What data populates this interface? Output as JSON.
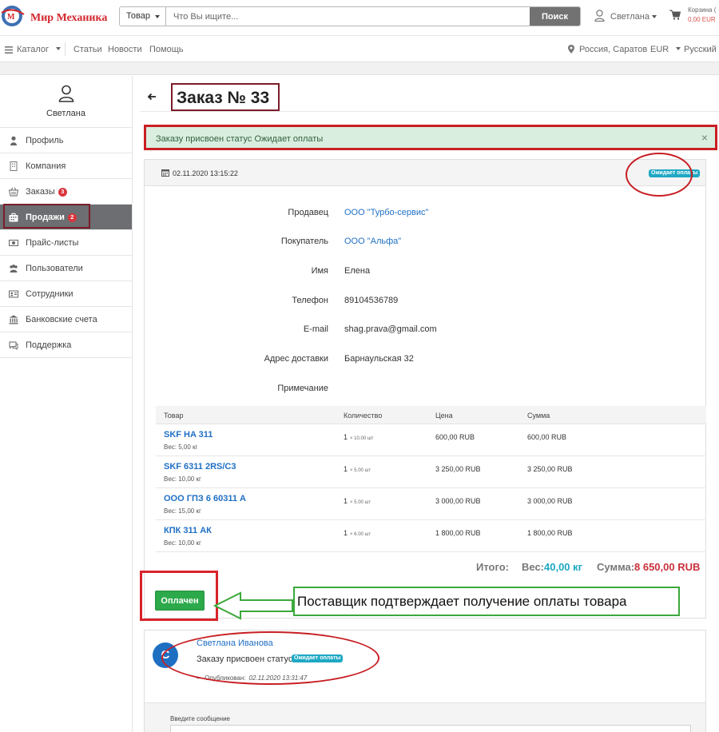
{
  "header": {
    "logo_text": "Мир Механика",
    "search": {
      "type_label": "Товар",
      "placeholder": "Что Вы ищите...",
      "button_label": "Поиск"
    },
    "user_label": "Светлана",
    "cart": {
      "label": "Корзина (",
      "total": "0,00 EUR"
    }
  },
  "nav": {
    "catalog": "Каталог",
    "articles": "Статьи",
    "news": "Новости",
    "help": "Помощь",
    "location": "Россия, Саратов",
    "currency": "EUR",
    "language": "Русский"
  },
  "sidebar": {
    "user_name": "Светлана",
    "items": [
      {
        "label": "Профиль",
        "icon": "person-icon"
      },
      {
        "label": "Компания",
        "icon": "building-icon"
      },
      {
        "label": "Заказы",
        "icon": "basket-icon",
        "badge": "3"
      },
      {
        "label": "Продажи",
        "icon": "sales-icon",
        "badge": "2",
        "active": true
      },
      {
        "label": "Прайс-листы",
        "icon": "money-icon"
      },
      {
        "label": "Пользователи",
        "icon": "users-icon"
      },
      {
        "label": "Сотрудники",
        "icon": "id-card-icon"
      },
      {
        "label": "Банковские счета",
        "icon": "bank-icon"
      },
      {
        "label": "Поддержка",
        "icon": "chat-icon"
      }
    ]
  },
  "page": {
    "title": "Заказ № 33",
    "alert": "Заказу присвоен статус Ожидает оплаты",
    "alert_close": "×"
  },
  "order": {
    "date": "02.11.2020 13:15:22",
    "status": "Ожидает оплаты",
    "fields": [
      {
        "label": "Продавец",
        "value": "ООО \"Турбо-сервис\"",
        "link": true
      },
      {
        "label": "Покупатель",
        "value": "ООО \"Альфа\"",
        "link": true
      },
      {
        "label": "Имя",
        "value": "Елена",
        "link": false
      },
      {
        "label": "Телефон",
        "value": "89104536789",
        "link": false
      },
      {
        "label": "E-mail",
        "value": "shag.prava@gmail.com",
        "link": false
      },
      {
        "label": "Адрес доставки",
        "value": "Барнаульская 32",
        "link": false
      },
      {
        "label": "Примечание",
        "value": "",
        "link": false
      }
    ],
    "table": {
      "headers": [
        "Товар",
        "Количество",
        "Цена",
        "Сумма"
      ],
      "rows": [
        {
          "name": "SKF HA 311",
          "weight": "Вес: 5,00 кг",
          "qty": "1",
          "qty_note": "× 10.00 шт",
          "price": "600,00 RUB",
          "sum": "600,00 RUB"
        },
        {
          "name": "SKF 6311 2RS/C3",
          "weight": "Вес: 10,00 кг",
          "qty": "1",
          "qty_note": "× 5.00 шт",
          "price": "3 250,00 RUB",
          "sum": "3 250,00 RUB"
        },
        {
          "name": "ООО ГПЗ 6 60311 А",
          "weight": "Вес: 15,00 кг",
          "qty": "1",
          "qty_note": "× 5.00 шт",
          "price": "3 000,00 RUB",
          "sum": "3 000,00 RUB"
        },
        {
          "name": "КПК 311 АК",
          "weight": "Вес: 10,00 кг",
          "qty": "1",
          "qty_note": "× 6.00 шт",
          "price": "1 800,00 RUB",
          "sum": "1 800,00 RUB"
        }
      ]
    },
    "totals": {
      "label": "Итого:",
      "weight_label": "Вес:",
      "weight_value": "40,00 кг",
      "sum_label": "Сумма:",
      "sum_value": "8 650,00 RUB"
    },
    "paid_button": "Оплачен",
    "annotation": "Поставщик подтверждает получение оплаты товара"
  },
  "comment": {
    "avatar_letter": "С",
    "author": "Светлана Иванова",
    "text": "Заказу присвоен статус",
    "status": "Ожидает оплаты",
    "meta_prefix": "— Опубликован:",
    "meta_date": "02.11.2020 13:31:47",
    "message_label": "Введите сообщение"
  },
  "colors": {
    "brand": "#d2262d",
    "link": "#1f6fc4",
    "status_pill": "#1fa8c4",
    "paid_button": "#2ca94a",
    "alert_bg": "#d9eedf",
    "highlight_red": "#c81f24",
    "highlight_green": "#3ba83b"
  }
}
